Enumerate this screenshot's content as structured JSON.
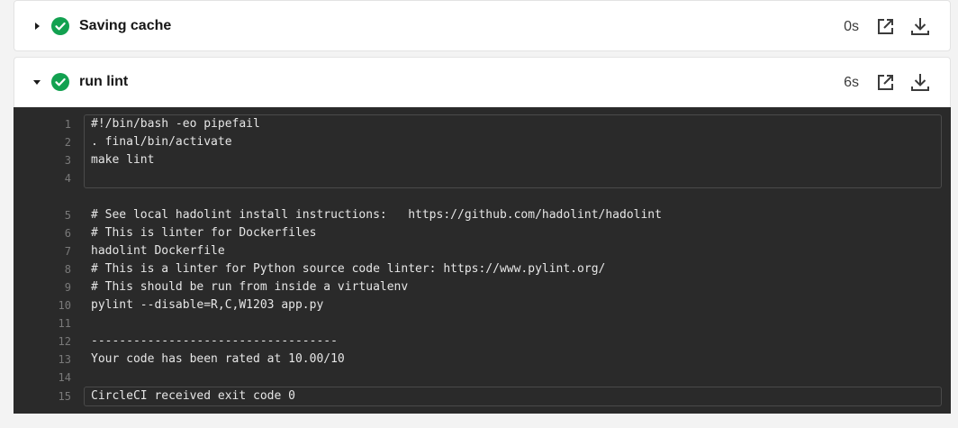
{
  "steps": [
    {
      "title": "Saving cache",
      "duration": "0s",
      "expanded": false,
      "status": "success"
    },
    {
      "title": "run lint",
      "duration": "6s",
      "expanded": true,
      "status": "success"
    }
  ],
  "icons": {
    "caret_collapsed": "caret-right-icon",
    "caret_expanded": "caret-down-icon",
    "status": "check-circle-icon",
    "open": "external-link-icon",
    "download": "download-icon"
  },
  "colors": {
    "success": "#12a150",
    "terminal_bg": "#2a2a2a",
    "terminal_text": "#e6e6e6",
    "line_number": "#7a7a7a"
  },
  "log": {
    "lines": [
      {
        "n": "1",
        "text": "#!/bin/bash -eo pipefail"
      },
      {
        "n": "2",
        "text": ". final/bin/activate"
      },
      {
        "n": "3",
        "text": "make lint"
      },
      {
        "n": "4",
        "text": ""
      },
      {
        "n": "5",
        "text": "# See local hadolint install instructions:   https://github.com/hadolint/hadolint"
      },
      {
        "n": "6",
        "text": "# This is linter for Dockerfiles"
      },
      {
        "n": "7",
        "text": "hadolint Dockerfile"
      },
      {
        "n": "8",
        "text": "# This is a linter for Python source code linter: https://www.pylint.org/"
      },
      {
        "n": "9",
        "text": "# This should be run from inside a virtualenv"
      },
      {
        "n": "10",
        "text": "pylint --disable=R,C,W1203 app.py"
      },
      {
        "n": "11",
        "text": ""
      },
      {
        "n": "12",
        "text": "-----------------------------------"
      },
      {
        "n": "13",
        "text": "Your code has been rated at 10.00/10"
      },
      {
        "n": "14",
        "text": ""
      },
      {
        "n": "15",
        "text": "CircleCI received exit code 0"
      }
    ]
  }
}
